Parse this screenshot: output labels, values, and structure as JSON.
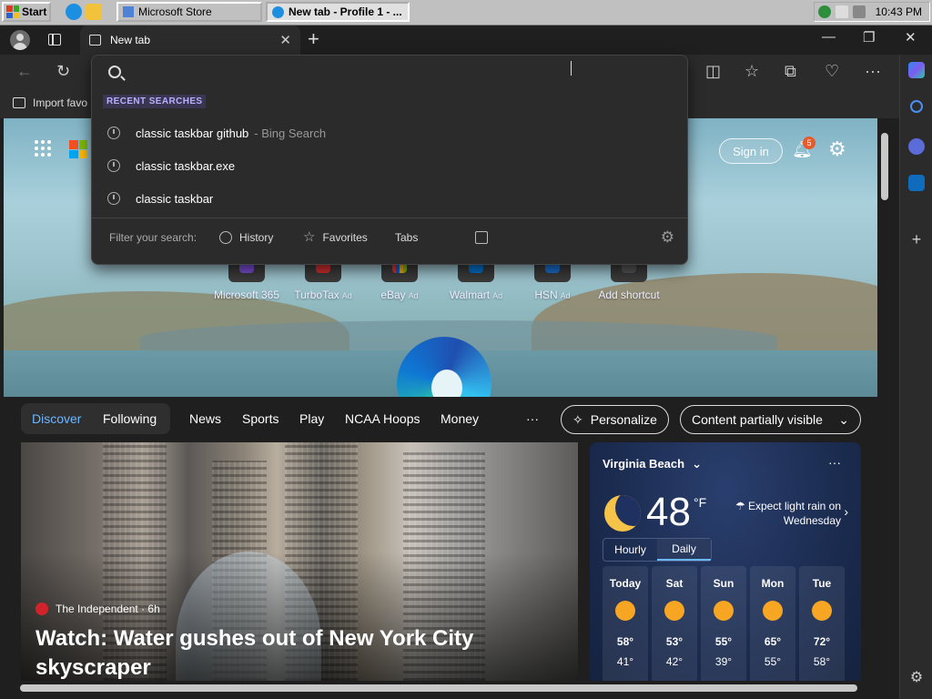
{
  "taskbar": {
    "start_label": "Start",
    "windows": [
      {
        "title": "Microsoft Store",
        "active": false
      },
      {
        "title": "New tab - Profile 1 - ...",
        "active": true
      }
    ],
    "clock": "10:43 PM"
  },
  "browser": {
    "tab_title": "New tab",
    "favorites_bar": {
      "import_label": "Import favo"
    }
  },
  "omnibox": {
    "section_title": "RECENT SEARCHES",
    "suggestions": [
      {
        "text": "classic taskbar github",
        "sub": "- Bing Search"
      },
      {
        "text": "classic taskbar.exe",
        "sub": ""
      },
      {
        "text": "classic taskbar",
        "sub": ""
      }
    ],
    "filter_label": "Filter your search:",
    "filters": [
      "History",
      "Favorites",
      "Tabs"
    ]
  },
  "ntp": {
    "sign_in": "Sign in",
    "notification_count": "5",
    "shortcuts": [
      {
        "label": "Microsoft 365",
        "ad": "",
        "color": "#7b4fd6"
      },
      {
        "label": "TurboTax",
        "ad": "Ad",
        "color": "#d42f2f"
      },
      {
        "label": "eBay",
        "ad": "Ad",
        "color": "#e53238"
      },
      {
        "label": "Walmart",
        "ad": "Ad",
        "color": "#0071ce"
      },
      {
        "label": "HSN",
        "ad": "Ad",
        "color": "#1a6fd0"
      },
      {
        "label": "Add shortcut",
        "ad": "",
        "color": "#555555"
      }
    ],
    "feed_nav": {
      "discover": "Discover",
      "following": "Following",
      "items": [
        "News",
        "Sports",
        "Play",
        "NCAA Hoops",
        "Money"
      ],
      "more": "···",
      "personalize": "Personalize",
      "visibility": "Content partially visible"
    },
    "article": {
      "source": "The Independent · 6h",
      "headline": "Watch: Water gushes out of New York City skyscraper"
    },
    "weather": {
      "city": "Virginia Beach",
      "temp": "48",
      "unit": "°F",
      "forecast": "Expect light rain on Wednesday",
      "toggle": [
        "Hourly",
        "Daily"
      ],
      "days": [
        {
          "name": "Today",
          "hi": "58°",
          "lo": "41°"
        },
        {
          "name": "Sat",
          "hi": "53°",
          "lo": "42°"
        },
        {
          "name": "Sun",
          "hi": "55°",
          "lo": "39°"
        },
        {
          "name": "Mon",
          "hi": "65°",
          "lo": "55°"
        },
        {
          "name": "Tue",
          "hi": "72°",
          "lo": "58°"
        }
      ]
    }
  },
  "colors": {
    "accent": "#6cb8ff",
    "badge": "#e65a2c"
  }
}
